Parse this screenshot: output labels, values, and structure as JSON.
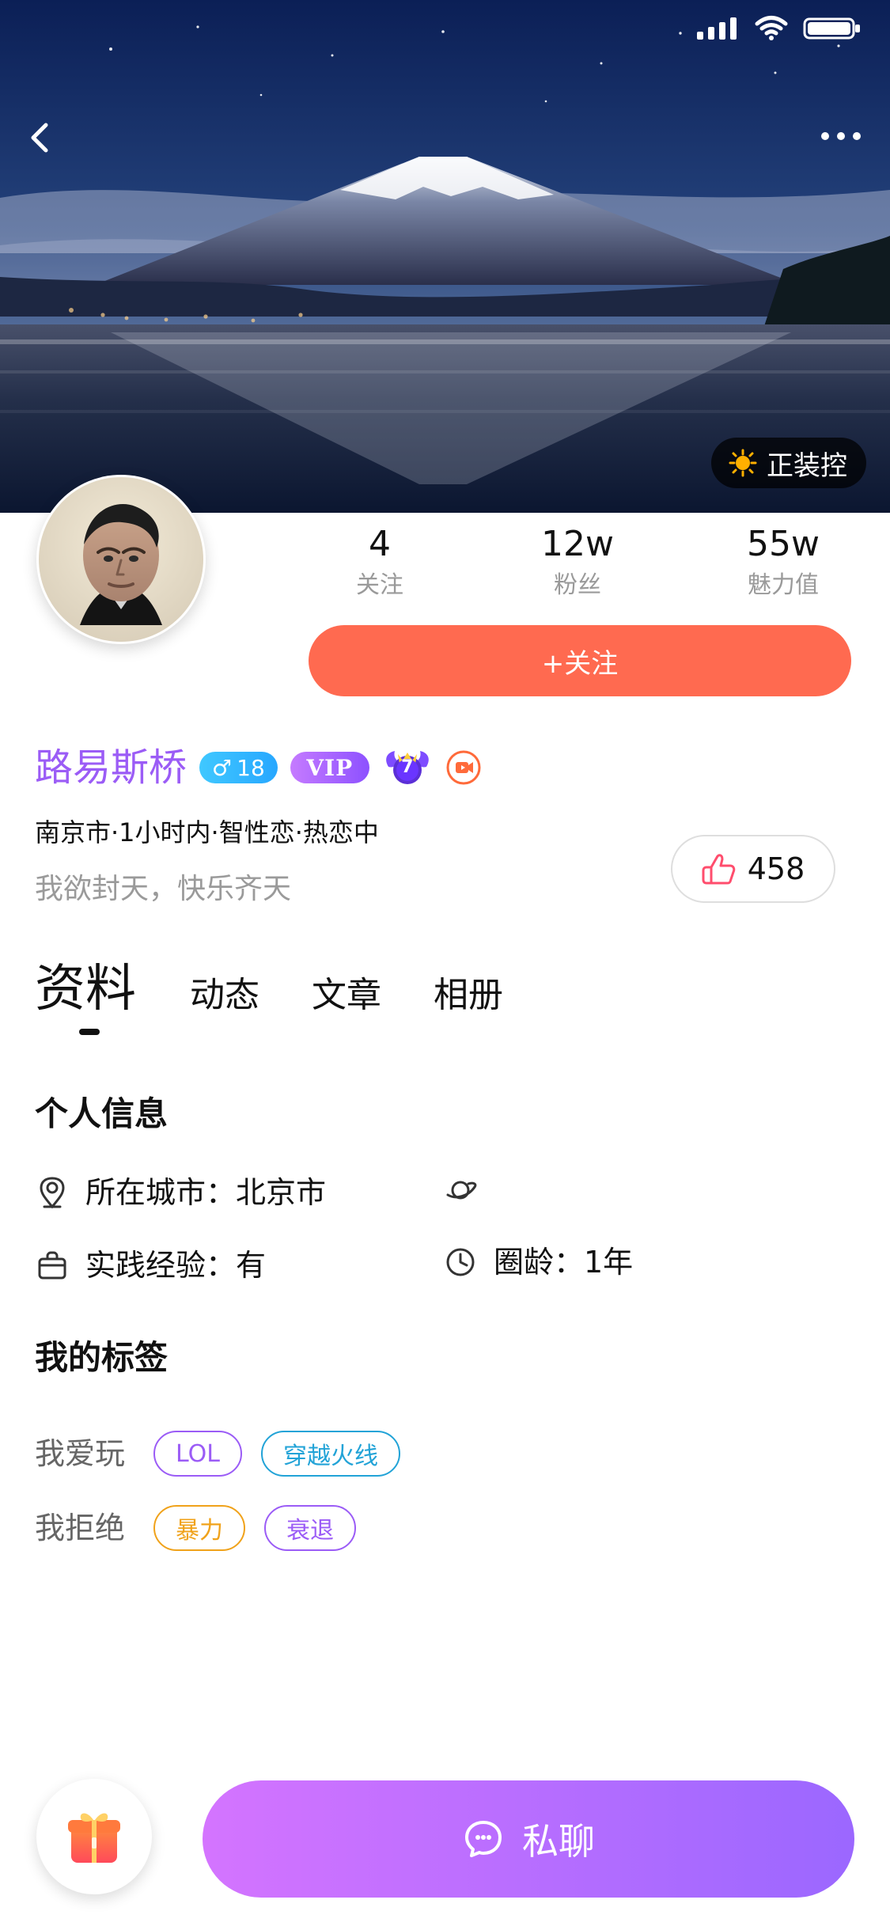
{
  "hero": {
    "badge": {
      "icon": "sun-badge-icon",
      "label": "正装控"
    }
  },
  "stats": [
    {
      "value": "4",
      "label": "关注"
    },
    {
      "value": "12w",
      "label": "粉丝"
    },
    {
      "value": "55w",
      "label": "魅力值"
    }
  ],
  "actions": {
    "follow": "+关注",
    "likes": "458",
    "chat": "私聊"
  },
  "profile": {
    "name": "路易斯桥",
    "gender_symbol": "♂",
    "age": "18",
    "vip": "VIP",
    "level": "7",
    "meta": "南京市·1小时内·智性恋·热恋中",
    "bio": "我欲封天，快乐齐天"
  },
  "tabs": [
    "资料",
    "动态",
    "文章",
    "相册"
  ],
  "personal_info": {
    "title": "个人信息",
    "city": "所在城市：北京市",
    "experience": "实践经验：有",
    "circle_age": "圈龄：1年"
  },
  "tags": {
    "title": "我的标签",
    "love": {
      "label": "我爱玩",
      "items": [
        "LOL",
        "穿越火线"
      ]
    },
    "refuse": {
      "label": "我拒绝",
      "items": [
        "暴力",
        "衰退"
      ]
    }
  },
  "colors": {
    "follow_bg": "#ff6a50",
    "name": "#9b5cf6",
    "chat_gradient": [
      "#d474ff",
      "#9b67ff"
    ],
    "tag_purple": "#9b5cf6",
    "tag_blue": "#22a3d7",
    "tag_orange": "#f0a21a"
  }
}
